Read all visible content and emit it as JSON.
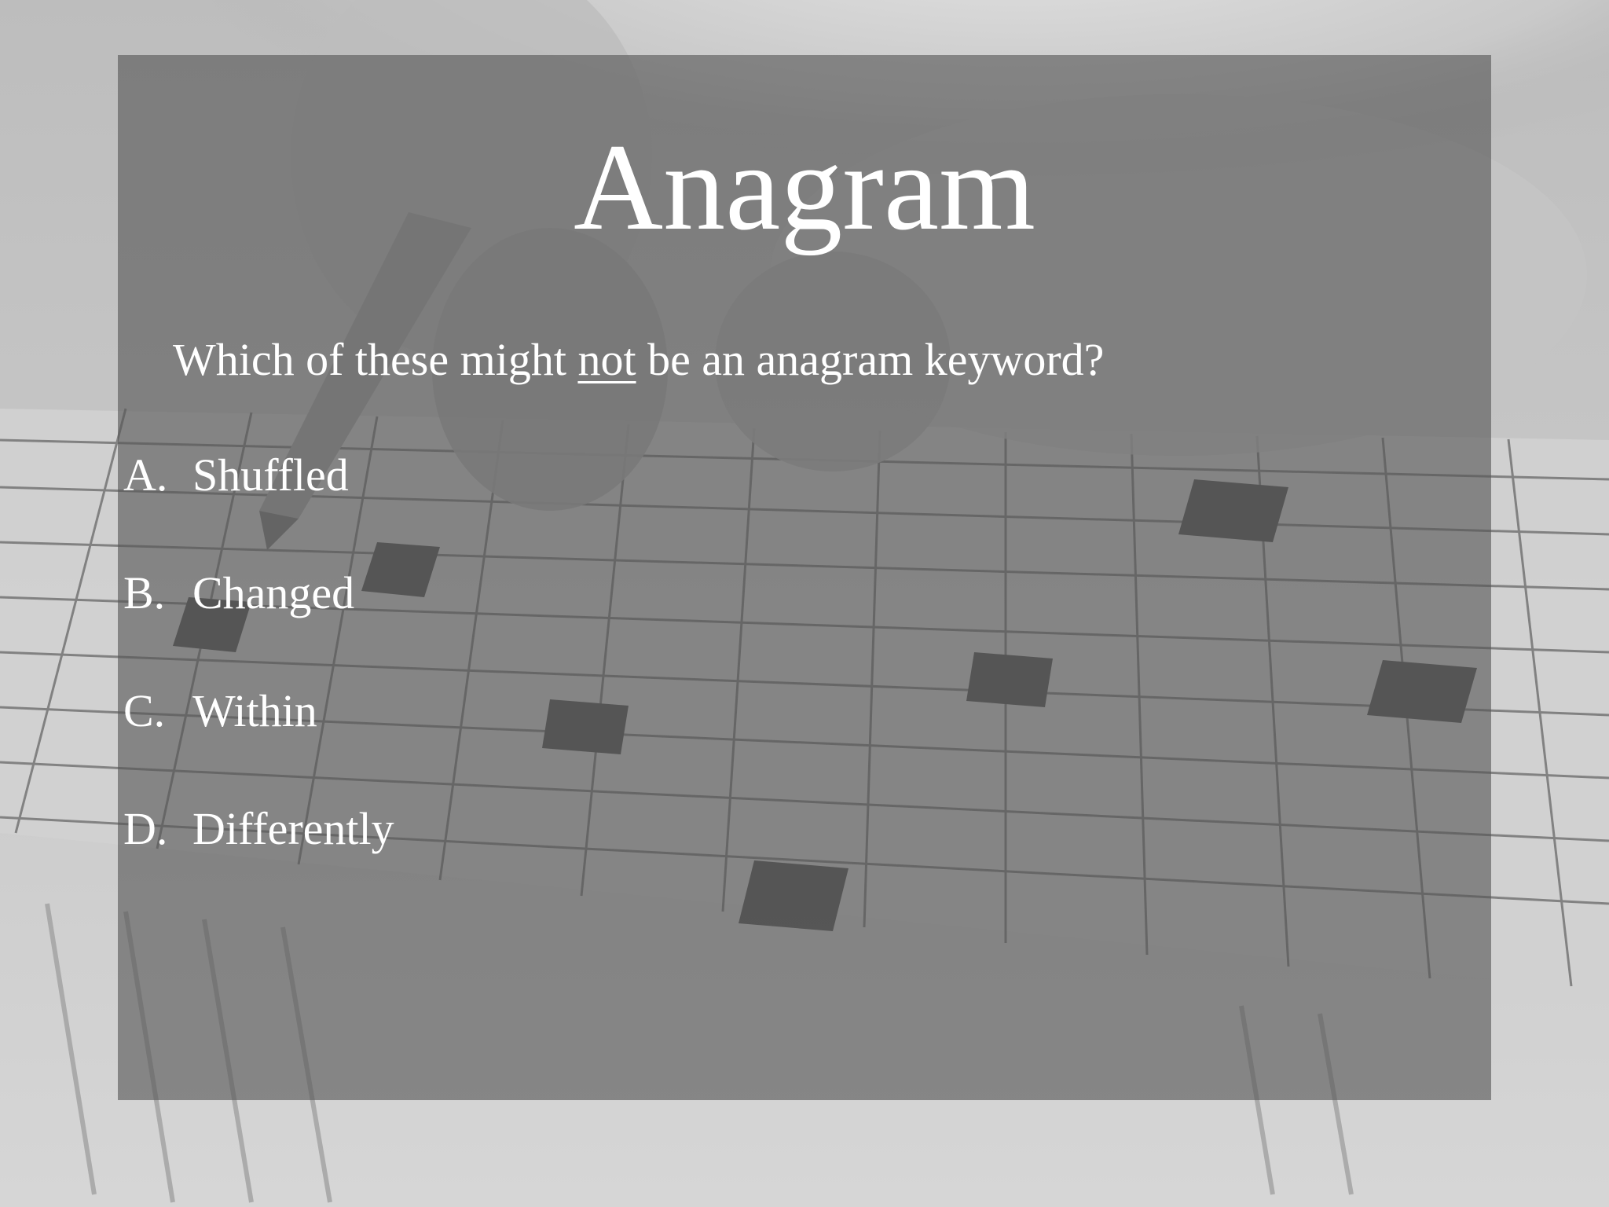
{
  "slide": {
    "title": "Anagram",
    "question": {
      "before": "Which of these might ",
      "emphasis": "not",
      "after": " be an anagram keyword?"
    },
    "options": [
      {
        "letter": "A.",
        "text": "Shuffled"
      },
      {
        "letter": "B.",
        "text": "Changed"
      },
      {
        "letter": "C.",
        "text": "Within"
      },
      {
        "letter": "D.",
        "text": "Differently"
      }
    ]
  },
  "background": {
    "description_icon": "crossword-photo",
    "panel_color": "#555555"
  }
}
